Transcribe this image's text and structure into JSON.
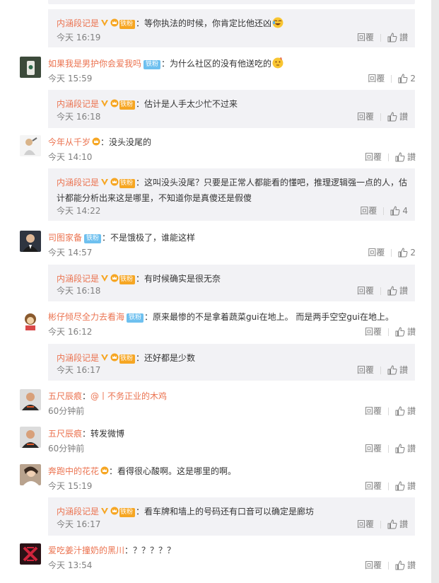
{
  "labels": {
    "reply": "回覆",
    "like": "讃",
    "iron_fan": "铁粉",
    "fan": "铁粉"
  },
  "colors": {
    "username": "#eb7350",
    "meta": "#808080",
    "reply_bg": "#f2f2f5"
  },
  "comments": [
    {
      "replies": [
        {
          "user": "内涵段记是",
          "text": "等你执法的时候，你肯定比他还凶",
          "emoji": "laughing-tears",
          "time": "今天 16:19",
          "likes": ""
        }
      ]
    },
    {
      "user": "如果我是男护你会爱我吗",
      "badge": "铁粉",
      "text": "为什么社区的没有他送吃的",
      "emoji": "thinking",
      "time": "今天 15:59",
      "likes": "2",
      "replies": [
        {
          "user": "内涵段记是",
          "text": "估计是人手太少忙不过来",
          "time": "今天 16:18",
          "likes": ""
        }
      ]
    },
    {
      "user": "今年从千岁",
      "text": "没头没尾的",
      "time": "今天 14:10",
      "likes": "",
      "replies": [
        {
          "user": "内涵段记是",
          "text": "这叫没头没尾？只要是正常人都能看的懂吧，推理逻辑强一点的人，估计都能分析出来这是哪里，不知道你是真傻还是假傻",
          "time": "今天 14:22",
          "likes": "4"
        }
      ]
    },
    {
      "user": "司图家备",
      "badge": "铁粉",
      "text": "不是饿极了，谁能这样",
      "time": "今天 14:57",
      "likes": "2",
      "replies": [
        {
          "user": "内涵段记是",
          "text": "有时候确实是很无奈",
          "time": "今天 16:18",
          "likes": ""
        }
      ]
    },
    {
      "user": "彬仔倾尽全力去看海",
      "badge": "铁粉",
      "text": "原来最惨的不是拿着蔬菜gui在地上。 而是两手空空gui在地上。",
      "time": "今天 16:12",
      "likes": "",
      "replies": [
        {
          "user": "内涵段记是",
          "text": "还好都是少数",
          "time": "今天 16:17",
          "likes": ""
        }
      ]
    },
    {
      "user": "五尺辰痕",
      "text": "@丨不务正业的木鸡",
      "time": "60分钟前",
      "likes": ""
    },
    {
      "user": "五尺辰痕",
      "text": "转发微博",
      "time": "60分钟前",
      "likes": ""
    },
    {
      "user": "奔跑中的花花",
      "text": "看得很心酸啊。这是哪里的啊。",
      "time": "今天 15:19",
      "likes": "",
      "replies": [
        {
          "user": "内涵段记是",
          "text": "看车牌和墙上的号码还有口音可以确定是廊坊",
          "time": "今天 16:17",
          "likes": ""
        }
      ]
    },
    {
      "user": "爱吃姜汁撞奶的黑川",
      "text": "？？？？？",
      "time": "今天 13:54",
      "likes": ""
    }
  ]
}
